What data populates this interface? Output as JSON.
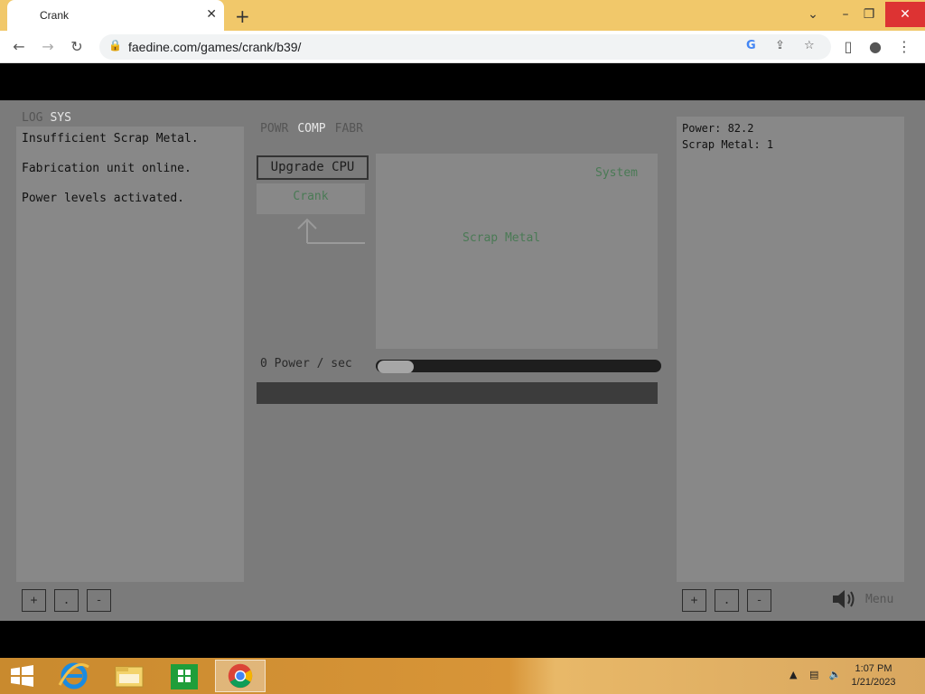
{
  "browser": {
    "tab_title": "Crank",
    "url": "faedine.com/games/crank/b39/"
  },
  "game": {
    "left_tabs": [
      "LOG",
      "SYS"
    ],
    "log_entries": [
      "Insufficient Scrap Metal.",
      "Fabrication unit online.",
      "Power levels activated."
    ],
    "center_tabs": [
      "POWR",
      "COMP",
      "FABR"
    ],
    "upgrade_button": "Upgrade CPU",
    "crank_button": "Crank",
    "system_label": "System",
    "scrap_label": "Scrap Metal",
    "rate_text": "0 Power / sec",
    "stats": [
      "Power: 82.2",
      "Scrap Metal: 1"
    ],
    "zoom_buttons": [
      "+",
      ".",
      "-"
    ],
    "menu_label": "Menu"
  },
  "taskbar": {
    "time": "1:07 PM",
    "date": "1/21/2023"
  }
}
